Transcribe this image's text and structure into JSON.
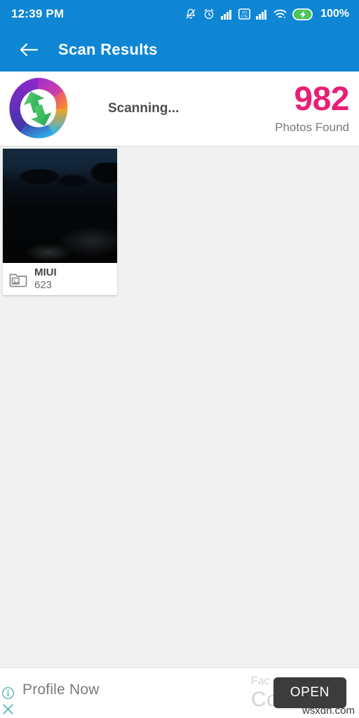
{
  "status_bar": {
    "time": "12:39 PM",
    "battery_percent": "100%",
    "icons": [
      "bell-muted-icon",
      "alarm-clock-icon",
      "signal-bars-icon",
      "volte-icon",
      "signal-bars-2-icon",
      "wifi-icon",
      "battery-charging-icon"
    ]
  },
  "app_bar": {
    "back_icon": "arrow-left-icon",
    "title": "Scan Results"
  },
  "summary": {
    "logo_icon": "recycle-swirl-logo",
    "status_text": "Scanning...",
    "count": "982",
    "count_label": "Photos Found"
  },
  "folders": [
    {
      "name": "MIUI",
      "count": "623",
      "icon": "folder-image-icon"
    }
  ],
  "ad": {
    "info_icon": "info-circle-icon",
    "close_icon": "close-x-icon",
    "primary_text": "Profile Now",
    "faded_text_1": "Fac",
    "faded_text_2": "Co",
    "open_label": "OPEN",
    "watermark": "wsxdn.com"
  },
  "colors": {
    "brand_blue": "#0e86d4",
    "accent_pink": "#e81f76",
    "ad_button": "#3c3c3c",
    "ad_link_teal": "#4fb3b8",
    "page_bg": "#f1f1f1"
  }
}
